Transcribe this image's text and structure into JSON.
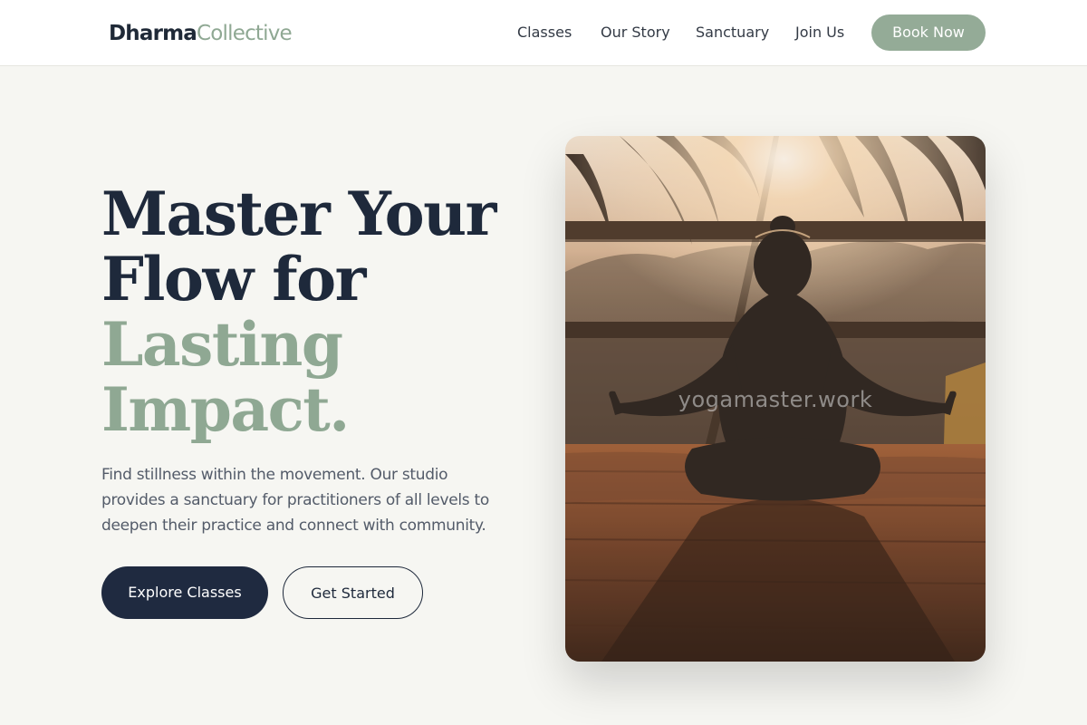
{
  "brand": {
    "part1": "Dharma",
    "part2": "Collective"
  },
  "nav": {
    "links": [
      "Classes",
      "Our Story",
      "Sanctuary",
      "Join Us"
    ],
    "cta": "Book Now"
  },
  "hero": {
    "title_lines": [
      "Master Your",
      "Flow for",
      "Lasting",
      "Impact."
    ],
    "description": "Find stillness within the movement. Our studio provides a sanctuary for practitioners of all levels to deepen their practice and connect with community.",
    "primary_button": "Explore Classes",
    "secondary_button": "Get Started",
    "image": {
      "subject": "silhouette of person meditating on wooden deck at sunrise with palm trees",
      "watermark": "yogamaster.work"
    }
  },
  "colors": {
    "navy": "#1e293b",
    "sage": "#8fa893",
    "background": "#f6f6f2",
    "button_dark": "#1f2a40"
  },
  "icons": []
}
